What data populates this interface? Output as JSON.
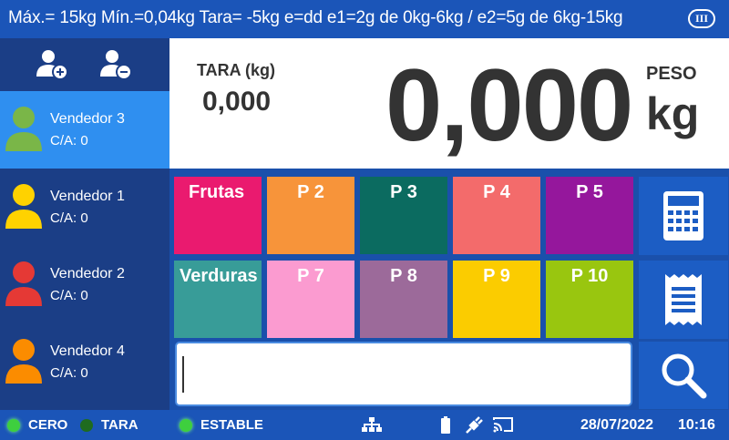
{
  "header": {
    "spec": "Máx.= 15kg  Mín.=0,04kg  Tara= -5kg  e=dd  e1=2g de 0kg-6kg / e2=5g de 6kg-15kg",
    "class_badge": "III"
  },
  "sidebar": {
    "actions": [
      {
        "icon": "add-user-icon"
      },
      {
        "icon": "remove-user-icon"
      }
    ],
    "vendors": [
      {
        "name": "Vendedor 3",
        "ca": "C/A: 0",
        "color": "#7ab648",
        "active": true
      },
      {
        "name": "Vendedor 1",
        "ca": "C/A: 0",
        "color": "#ffd200",
        "active": false
      },
      {
        "name": "Vendedor 2",
        "ca": "C/A: 0",
        "color": "#e53935",
        "active": false
      },
      {
        "name": "Vendedor 4",
        "ca": "C/A: 0",
        "color": "#fb8c00",
        "active": false
      }
    ]
  },
  "display": {
    "tara_label": "TARA (kg)",
    "tara_value": "0,000",
    "peso_label": "PESO",
    "weight": "0,000",
    "unit": "kg"
  },
  "presets": [
    {
      "label": "Frutas",
      "color": "#ea1a6f"
    },
    {
      "label": "P 2",
      "color": "#f7943a"
    },
    {
      "label": "P 3",
      "color": "#0b6b60"
    },
    {
      "label": "P 4",
      "color": "#f36b6b"
    },
    {
      "label": "P 5",
      "color": "#95179c"
    },
    {
      "label": "Verduras",
      "color": "#389c98"
    },
    {
      "label": "P 7",
      "color": "#fb9bd0"
    },
    {
      "label": "P 8",
      "color": "#9c6a9a"
    },
    {
      "label": "P 9",
      "color": "#fbcc00"
    },
    {
      "label": "P 10",
      "color": "#99c60f"
    }
  ],
  "side_buttons": [
    {
      "icon": "calculator-icon"
    },
    {
      "icon": "receipt-icon"
    },
    {
      "icon": "search-icon"
    }
  ],
  "input": {
    "value": "",
    "placeholder": ""
  },
  "status": {
    "indicators": [
      {
        "label": "CERO",
        "led": "#3ecf3e"
      },
      {
        "label": "TARA",
        "led": "#1f6b1f"
      },
      {
        "label": "ESTABLE",
        "led": "#3ecf3e"
      }
    ],
    "icons": [
      "network-icon",
      "battery-icon",
      "power-plug-icon",
      "cast-icon"
    ],
    "date": "28/07/2022",
    "time": "10:16"
  }
}
